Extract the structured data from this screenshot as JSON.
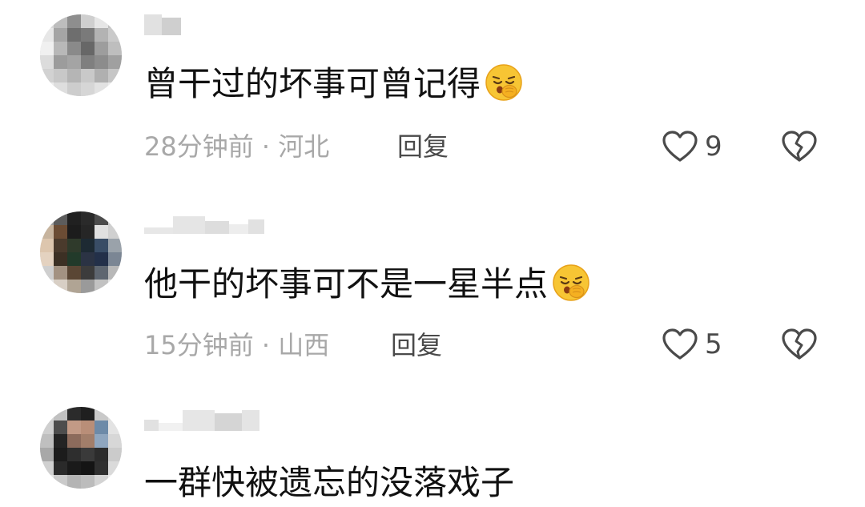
{
  "comments": [
    {
      "text": "曾干过的坏事可曾记得",
      "emoji": "shushing-face-icon",
      "time": "28分钟前",
      "separator": " · ",
      "location": "河北",
      "reply_label": "回复",
      "like_count": "9"
    },
    {
      "text": "他干的坏事可不是一星半点",
      "emoji": "shushing-face-icon",
      "time": "15分钟前",
      "separator": " · ",
      "location": "山西",
      "reply_label": "回复",
      "like_count": "5"
    },
    {
      "text": "一群快被遗忘的没落戏子"
    }
  ],
  "colors": {
    "text": "#111111",
    "meta": "#a8a8a8",
    "reply": "#4a4a4a",
    "icon": "#4a4a4a",
    "emoji_face": "#f7c534"
  }
}
